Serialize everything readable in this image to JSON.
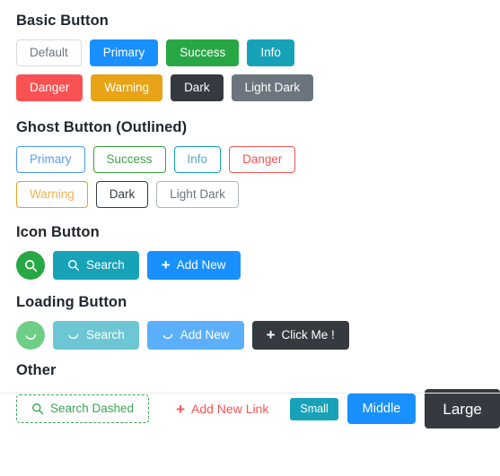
{
  "sections": [
    {
      "id": "basic",
      "title": "Basic Button",
      "rows": [
        [
          {
            "label": "Default",
            "variant": "default"
          },
          {
            "label": "Primary",
            "variant": "primary"
          },
          {
            "label": "Success",
            "variant": "success"
          },
          {
            "label": "Info",
            "variant": "info"
          }
        ],
        [
          {
            "label": "Danger",
            "variant": "danger"
          },
          {
            "label": "Warning",
            "variant": "warning"
          },
          {
            "label": "Dark",
            "variant": "dark"
          },
          {
            "label": "Light Dark",
            "variant": "lightdark"
          }
        ]
      ]
    },
    {
      "id": "ghost",
      "title": "Ghost Button (Outlined)",
      "rows": [
        [
          {
            "label": "Primary",
            "variant": "primary"
          },
          {
            "label": "Success",
            "variant": "success"
          },
          {
            "label": "Info",
            "variant": "info"
          },
          {
            "label": "Danger",
            "variant": "danger"
          }
        ],
        [
          {
            "label": "Warning",
            "variant": "warning"
          },
          {
            "label": "Dark",
            "variant": "dark"
          },
          {
            "label": "Light Dark",
            "variant": "lightdark"
          }
        ]
      ]
    },
    {
      "id": "icon",
      "title": "Icon Button",
      "buttons": [
        {
          "label": "",
          "icon": "search-icon",
          "variant": "success",
          "shape": "circle"
        },
        {
          "label": "Search",
          "icon": "search-icon",
          "variant": "info"
        },
        {
          "label": "Add New",
          "icon": "plus-icon",
          "variant": "primary"
        }
      ]
    },
    {
      "id": "loading",
      "title": "Loading Button",
      "buttons": [
        {
          "label": "",
          "icon": "loading-spinner-icon",
          "variant": "success-l",
          "shape": "circle"
        },
        {
          "label": "Search",
          "icon": "loading-spinner-icon",
          "variant": "info-l"
        },
        {
          "label": "Add New",
          "icon": "loading-spinner-icon",
          "variant": "primary-l"
        },
        {
          "label": "Click Me !",
          "icon": "plus-icon",
          "variant": "dark"
        }
      ]
    },
    {
      "id": "other",
      "title": "Other",
      "dashed_button": {
        "label": "Search Dashed",
        "icon": "search-icon"
      },
      "link_button": {
        "label": "Add New Link",
        "icon": "plus-icon"
      },
      "size_buttons": [
        {
          "label": "Small",
          "size": "small"
        },
        {
          "label": "Middle",
          "size": "middle"
        },
        {
          "label": "Large",
          "size": "large"
        }
      ]
    }
  ],
  "colors": {
    "primary": "#1890ff",
    "success": "#28a745",
    "info": "#17a2b8",
    "danger": "#fa5252",
    "warning": "#e8a317",
    "dark": "#343a40",
    "light_dark": "#6c757d",
    "dashed_green": "#3aa655",
    "default_border": "#d9d9d9"
  }
}
